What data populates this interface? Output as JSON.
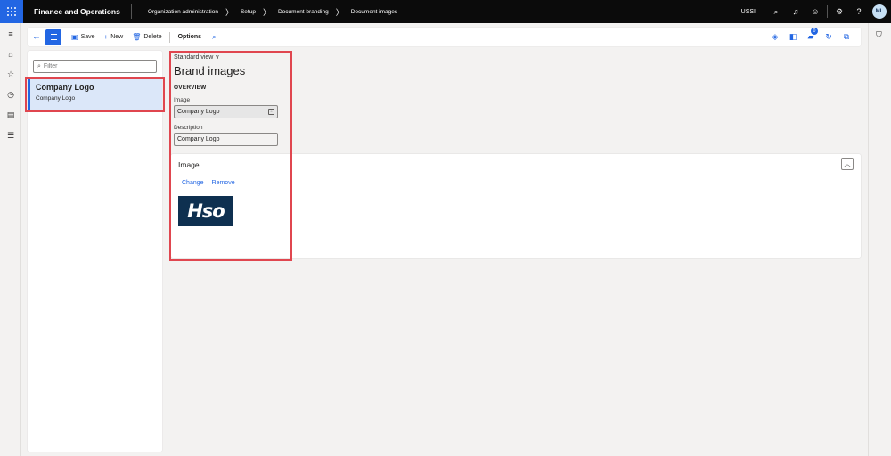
{
  "topbar": {
    "app_name": "Finance and Operations",
    "breadcrumbs": [
      "Organization administration",
      "Setup",
      "Document branding",
      "Document images"
    ],
    "company": "USSI",
    "avatar_initials": "ML"
  },
  "actionpane": {
    "save_label": "Save",
    "new_label": "New",
    "delete_label": "Delete",
    "options_label": "Options",
    "badge_count": "0"
  },
  "list": {
    "filter_placeholder": "Filter",
    "items": [
      {
        "title": "Company Logo",
        "subtitle": "Company Logo"
      }
    ]
  },
  "form": {
    "view_label": "Standard view",
    "title": "Brand images",
    "section_overview": "OVERVIEW",
    "image_label": "Image",
    "image_value": "Company Logo",
    "description_label": "Description",
    "description_value": "Company Logo"
  },
  "image_card": {
    "header": "Image",
    "change_label": "Change",
    "remove_label": "Remove",
    "logo_text": "Hso"
  },
  "colors": {
    "accent": "#2266e3",
    "highlight": "#e0464f",
    "logo_bg": "#0e3050"
  }
}
